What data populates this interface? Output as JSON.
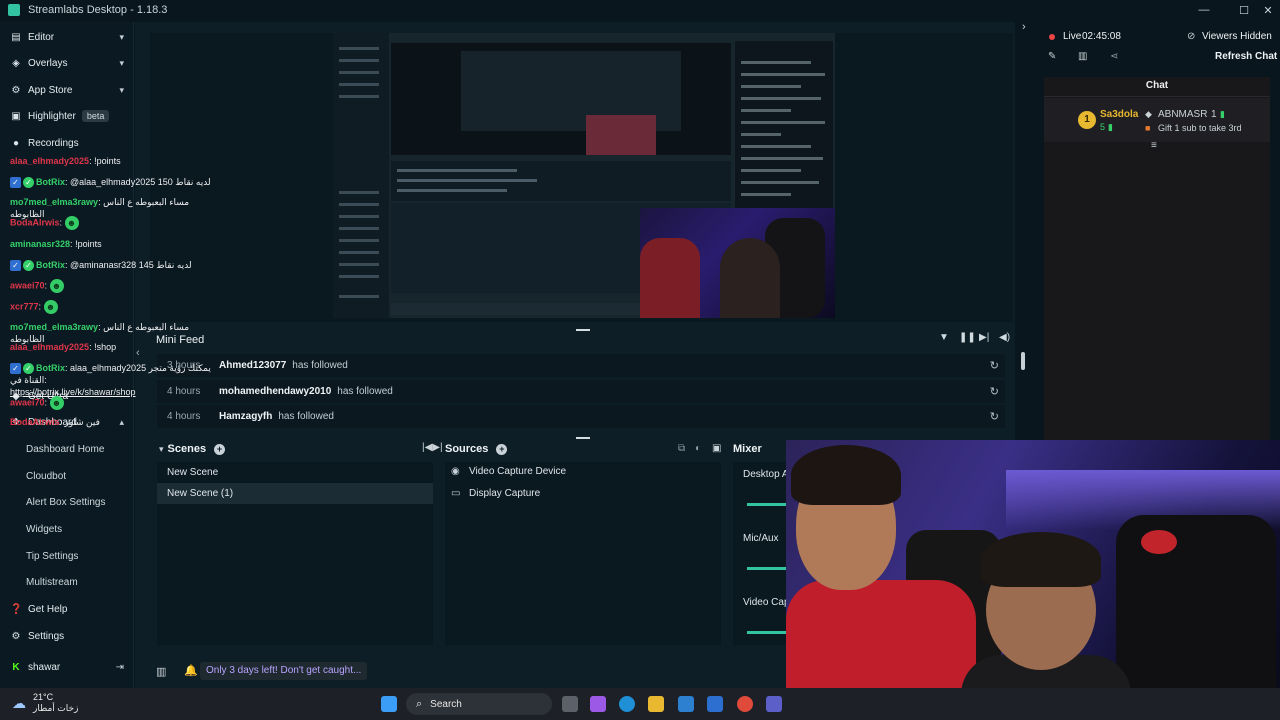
{
  "window": {
    "title": "Streamlabs Desktop - 1.18.3"
  },
  "sidebar": {
    "top_items": [
      {
        "label": "Editor",
        "icon": "editor-icon",
        "chevron": "▾"
      },
      {
        "label": "Overlays",
        "icon": "overlays-icon",
        "chevron": "▾"
      },
      {
        "label": "App Store",
        "icon": "app-store-icon",
        "chevron": "▾"
      },
      {
        "label": "Highlighter",
        "icon": "highlighter-icon",
        "badge": "beta"
      },
      {
        "label": "Recordings",
        "icon": "recordings-icon"
      }
    ],
    "bottom_items": [
      {
        "label": "Get Ultra",
        "icon": "ultra-icon"
      },
      {
        "label": "Dashboard",
        "icon": "dashboard-icon",
        "chevron": "▴"
      },
      {
        "label": "Dashboard Home"
      },
      {
        "label": "Cloudbot"
      },
      {
        "label": "Alert Box Settings"
      },
      {
        "label": "Widgets"
      },
      {
        "label": "Tip Settings"
      },
      {
        "label": "Multistream"
      },
      {
        "label": "Get Help",
        "icon": "help-icon"
      },
      {
        "label": "Settings",
        "icon": "settings-icon"
      }
    ],
    "user": {
      "name": "shawar"
    }
  },
  "mini_feed": {
    "title": "Mini Feed",
    "rows": [
      {
        "time": "3 hours",
        "user": "Ahmed123077",
        "action": "has followed"
      },
      {
        "time": "4 hours",
        "user": "mohamedhendawy2010",
        "action": "has followed"
      },
      {
        "time": "4 hours",
        "user": "Hamzagyfh",
        "action": "has followed"
      }
    ]
  },
  "scenes": {
    "title": "Scenes",
    "items": [
      "New Scene",
      "New Scene (1)"
    ],
    "selected": 1
  },
  "sources": {
    "title": "Sources",
    "items": [
      {
        "label": "Video Capture Device",
        "icon": "camera-icon"
      },
      {
        "label": "Display Capture",
        "icon": "monitor-icon"
      }
    ]
  },
  "mixer": {
    "title": "Mixer",
    "channels": [
      "Desktop A",
      "Mic/Aux",
      "Video Cap"
    ]
  },
  "status_bar": {
    "promo": "Only 3 days left! Don't get caught..."
  },
  "stream": {
    "live_label": "Live",
    "uptime": "02:45:08",
    "viewers": "Viewers Hidden",
    "refresh": "Refresh Chat"
  },
  "chat": {
    "title": "Chat",
    "top_gifter": {
      "rank": "1",
      "name": "Sa3dola",
      "count": "5"
    },
    "gift_promo": {
      "name": "ABNMASR",
      "count": "1",
      "text": "Gift 1 sub to take 3rd"
    },
    "messages": [
      {
        "user": "alaa_elhmady2025",
        "color": "#e0354a",
        "text": "!points"
      },
      {
        "user": "BotRix",
        "color": "#35d06a",
        "text": "@alaa_elhmady2025 لديه نقاط 150"
      },
      {
        "user": "mo7med_elma3rawy",
        "color": "#35d06a",
        "text": "مساء البعبوطه ع الناس الظابوطه"
      },
      {
        "user": "BodaAlrwis",
        "color": "#e0354a",
        "text": ""
      },
      {
        "user": "aminanasr328",
        "color": "#35d06a",
        "text": "!points"
      },
      {
        "user": "BotRix",
        "color": "#35d06a",
        "text": "@aminanasr328 لديه نقاط 145"
      },
      {
        "user": "awaei70",
        "color": "#e0354a",
        "text": ""
      },
      {
        "user": "xcr777",
        "color": "#e0354a",
        "text": ""
      },
      {
        "user": "mo7med_elma3rawy",
        "color": "#35d06a",
        "text": "مساء البعبوطه ع الناس الظابوطه"
      },
      {
        "user": "alaa_elhmady2025",
        "color": "#e0354a",
        "text": "!shop"
      },
      {
        "user": "BotRix",
        "color": "#35d06a",
        "text": "alaa_elhmady2025 يمكنك رؤية متجر القناة في:",
        "link": "https://botrix.live/k/shawar/shop"
      },
      {
        "user": "awaei70",
        "color": "#e0354a",
        "text": ""
      },
      {
        "user": "BodaAlrwis",
        "color": "#e0354a",
        "text": "فين شاور"
      }
    ]
  },
  "taskbar": {
    "temp": "21°C",
    "weather": "زخات أمطار",
    "search": "Search"
  },
  "colors": {
    "accent": "#31c3a2",
    "live": "#ee4444",
    "promo": "#b9a4ff"
  }
}
